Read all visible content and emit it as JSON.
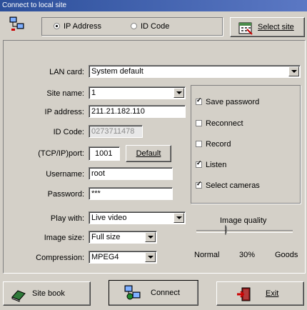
{
  "window": {
    "title": "Connect to local site"
  },
  "mode": {
    "ip_label": "IP Address",
    "id_label": "ID Code",
    "selected": "ip"
  },
  "toolbar": {
    "select_site_label": "Select site"
  },
  "form": {
    "lan_card_label": "LAN card:",
    "lan_card_value": "System default",
    "site_name_label": "Site name:",
    "site_name_value": "1",
    "ip_label": "IP address:",
    "ip_value": "211.21.182.110",
    "id_code_label": "ID Code:",
    "id_code_value": "0273711478",
    "port_label": "(TCP/IP)port:",
    "port_value": "1001",
    "default_button": "Default",
    "username_label": "Username:",
    "username_value": "root",
    "password_label": "Password:",
    "password_value": "***",
    "play_with_label": "Play with:",
    "play_with_value": "Live video",
    "image_size_label": "Image size:",
    "image_size_value": "Full size",
    "compression_label": "Compression:",
    "compression_value": "MPEG4"
  },
  "options": {
    "save_password": {
      "label": "Save password",
      "checked": true
    },
    "reconnect": {
      "label": "Reconnect",
      "checked": false
    },
    "record": {
      "label": "Record",
      "checked": false
    },
    "listen": {
      "label": "Listen",
      "checked": true
    },
    "select_cameras": {
      "label": "Select cameras",
      "checked": true
    }
  },
  "quality": {
    "title": "Image quality",
    "left_label": "Normal",
    "value_label": "30%",
    "right_label": "Goods",
    "value": 0.3
  },
  "footer": {
    "site_book_label": "Site book",
    "connect_label": "Connect",
    "exit_label": "Exit"
  }
}
